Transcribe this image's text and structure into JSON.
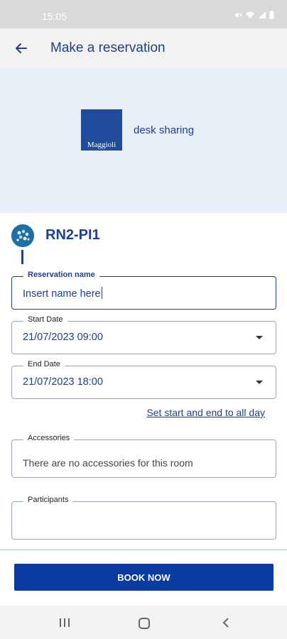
{
  "status_bar": {
    "time": "15:05",
    "icons": [
      "mute-icon",
      "wifi-icon",
      "signal-icon",
      "battery-icon"
    ]
  },
  "app_bar": {
    "title": "Make a reservation",
    "back_icon": "arrow-left-icon"
  },
  "banner": {
    "logo_text": "Maggioli",
    "subtitle": "desk sharing",
    "background": "#e8eef5",
    "logo_color": "#1f4b9a"
  },
  "room": {
    "name": "RN2-PI1",
    "icon": "room-icon"
  },
  "form": {
    "reservation_name": {
      "label": "Reservation name",
      "value": "Insert name here"
    },
    "start_date": {
      "label": "Start Date",
      "value": "21/07/2023 09:00"
    },
    "end_date": {
      "label": "End Date",
      "value": "21/07/2023 18:00"
    },
    "all_day_link": "Set start and end to all day",
    "accessories": {
      "label": "Accessories",
      "value": "There are no accessories for this room"
    },
    "participants": {
      "label": "Participants",
      "value": ""
    }
  },
  "actions": {
    "book_label": "BOOK NOW",
    "book_color": "#0b3aa0"
  },
  "colors": {
    "accent": "#1c3f94"
  }
}
